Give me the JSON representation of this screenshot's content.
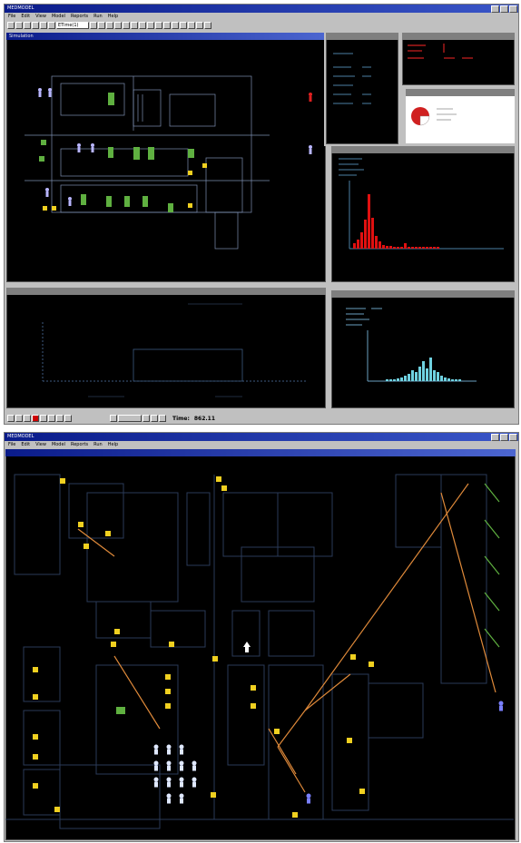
{
  "screen1": {
    "title": "MEDMODEL",
    "menu": [
      "File",
      "Edit",
      "View",
      "Model",
      "Reports",
      "Run",
      "Help"
    ],
    "toolbar_select": "ETime(1)",
    "windows": {
      "floorplan": "Simulation",
      "stats_left": "",
      "counter": "",
      "pie": "",
      "histogram_red": "",
      "timeline": "",
      "histogram_cyan": ""
    },
    "time_label": "Time:",
    "time_value": "862.11",
    "colors": {
      "red_bar": "#e01010",
      "cyan_bar": "#6fd1e0",
      "wall": "#8fa0c0",
      "marker": "#f2d21a"
    }
  },
  "screen2": {
    "title": "MEDMODEL",
    "menu": [
      "File",
      "Edit",
      "View",
      "Model",
      "Reports",
      "Run",
      "Help"
    ],
    "window_title": "",
    "colors": {
      "floor": "#000000",
      "wall": "#22304a",
      "path": "#e08a3a",
      "marker": "#f0d020",
      "patient": "#dfe8ff"
    }
  }
}
